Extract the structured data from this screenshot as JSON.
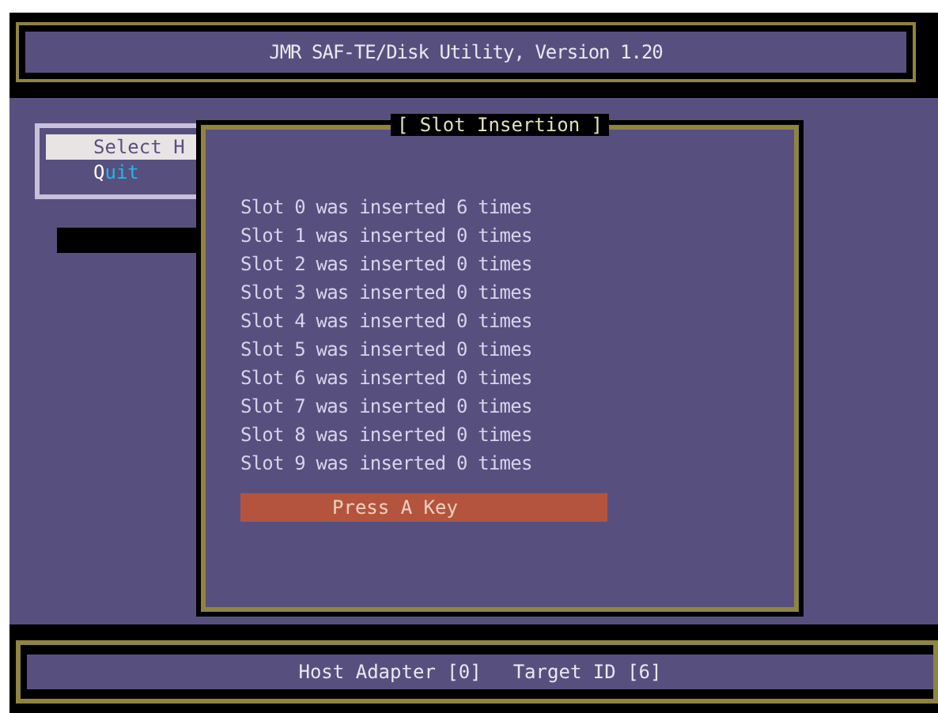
{
  "window": {
    "title": "JMR SAF-TE/Disk Utility, Version 1.20"
  },
  "menu": [
    {
      "label": "Select H",
      "selected": true
    },
    {
      "label": "uit",
      "hotkey": "Q",
      "selected": false
    }
  ],
  "dialog": {
    "title": "[ Slot Insertion ]",
    "lines": [
      "Slot 0 was inserted 6 times",
      "Slot 1 was inserted 0 times",
      "Slot 2 was inserted 0 times",
      "Slot 3 was inserted 0 times",
      "Slot 4 was inserted 0 times",
      "Slot 5 was inserted 0 times",
      "Slot 6 was inserted 0 times",
      "Slot 7 was inserted 0 times",
      "Slot 8 was inserted 0 times",
      "Slot 9 was inserted 0 times"
    ],
    "button": "Press A Key"
  },
  "status_bar": {
    "host_adapter": "Host Adapter [0]",
    "target_id": "Target ID [6]"
  }
}
